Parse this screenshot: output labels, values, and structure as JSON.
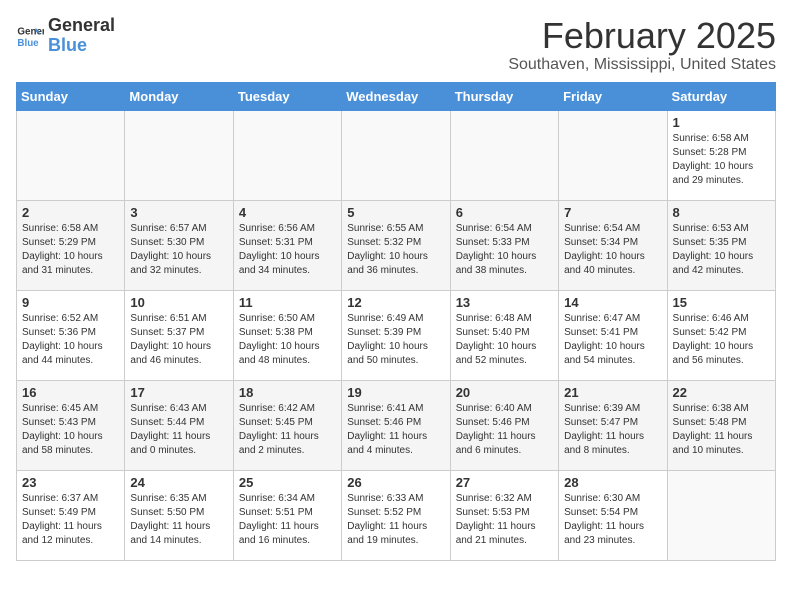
{
  "header": {
    "logo_text_general": "General",
    "logo_text_blue": "Blue",
    "month": "February 2025",
    "location": "Southaven, Mississippi, United States"
  },
  "days_of_week": [
    "Sunday",
    "Monday",
    "Tuesday",
    "Wednesday",
    "Thursday",
    "Friday",
    "Saturday"
  ],
  "weeks": [
    [
      {
        "day": "",
        "info": ""
      },
      {
        "day": "",
        "info": ""
      },
      {
        "day": "",
        "info": ""
      },
      {
        "day": "",
        "info": ""
      },
      {
        "day": "",
        "info": ""
      },
      {
        "day": "",
        "info": ""
      },
      {
        "day": "1",
        "info": "Sunrise: 6:58 AM\nSunset: 5:28 PM\nDaylight: 10 hours and 29 minutes."
      }
    ],
    [
      {
        "day": "2",
        "info": "Sunrise: 6:58 AM\nSunset: 5:29 PM\nDaylight: 10 hours and 31 minutes."
      },
      {
        "day": "3",
        "info": "Sunrise: 6:57 AM\nSunset: 5:30 PM\nDaylight: 10 hours and 32 minutes."
      },
      {
        "day": "4",
        "info": "Sunrise: 6:56 AM\nSunset: 5:31 PM\nDaylight: 10 hours and 34 minutes."
      },
      {
        "day": "5",
        "info": "Sunrise: 6:55 AM\nSunset: 5:32 PM\nDaylight: 10 hours and 36 minutes."
      },
      {
        "day": "6",
        "info": "Sunrise: 6:54 AM\nSunset: 5:33 PM\nDaylight: 10 hours and 38 minutes."
      },
      {
        "day": "7",
        "info": "Sunrise: 6:54 AM\nSunset: 5:34 PM\nDaylight: 10 hours and 40 minutes."
      },
      {
        "day": "8",
        "info": "Sunrise: 6:53 AM\nSunset: 5:35 PM\nDaylight: 10 hours and 42 minutes."
      }
    ],
    [
      {
        "day": "9",
        "info": "Sunrise: 6:52 AM\nSunset: 5:36 PM\nDaylight: 10 hours and 44 minutes."
      },
      {
        "day": "10",
        "info": "Sunrise: 6:51 AM\nSunset: 5:37 PM\nDaylight: 10 hours and 46 minutes."
      },
      {
        "day": "11",
        "info": "Sunrise: 6:50 AM\nSunset: 5:38 PM\nDaylight: 10 hours and 48 minutes."
      },
      {
        "day": "12",
        "info": "Sunrise: 6:49 AM\nSunset: 5:39 PM\nDaylight: 10 hours and 50 minutes."
      },
      {
        "day": "13",
        "info": "Sunrise: 6:48 AM\nSunset: 5:40 PM\nDaylight: 10 hours and 52 minutes."
      },
      {
        "day": "14",
        "info": "Sunrise: 6:47 AM\nSunset: 5:41 PM\nDaylight: 10 hours and 54 minutes."
      },
      {
        "day": "15",
        "info": "Sunrise: 6:46 AM\nSunset: 5:42 PM\nDaylight: 10 hours and 56 minutes."
      }
    ],
    [
      {
        "day": "16",
        "info": "Sunrise: 6:45 AM\nSunset: 5:43 PM\nDaylight: 10 hours and 58 minutes."
      },
      {
        "day": "17",
        "info": "Sunrise: 6:43 AM\nSunset: 5:44 PM\nDaylight: 11 hours and 0 minutes."
      },
      {
        "day": "18",
        "info": "Sunrise: 6:42 AM\nSunset: 5:45 PM\nDaylight: 11 hours and 2 minutes."
      },
      {
        "day": "19",
        "info": "Sunrise: 6:41 AM\nSunset: 5:46 PM\nDaylight: 11 hours and 4 minutes."
      },
      {
        "day": "20",
        "info": "Sunrise: 6:40 AM\nSunset: 5:46 PM\nDaylight: 11 hours and 6 minutes."
      },
      {
        "day": "21",
        "info": "Sunrise: 6:39 AM\nSunset: 5:47 PM\nDaylight: 11 hours and 8 minutes."
      },
      {
        "day": "22",
        "info": "Sunrise: 6:38 AM\nSunset: 5:48 PM\nDaylight: 11 hours and 10 minutes."
      }
    ],
    [
      {
        "day": "23",
        "info": "Sunrise: 6:37 AM\nSunset: 5:49 PM\nDaylight: 11 hours and 12 minutes."
      },
      {
        "day": "24",
        "info": "Sunrise: 6:35 AM\nSunset: 5:50 PM\nDaylight: 11 hours and 14 minutes."
      },
      {
        "day": "25",
        "info": "Sunrise: 6:34 AM\nSunset: 5:51 PM\nDaylight: 11 hours and 16 minutes."
      },
      {
        "day": "26",
        "info": "Sunrise: 6:33 AM\nSunset: 5:52 PM\nDaylight: 11 hours and 19 minutes."
      },
      {
        "day": "27",
        "info": "Sunrise: 6:32 AM\nSunset: 5:53 PM\nDaylight: 11 hours and 21 minutes."
      },
      {
        "day": "28",
        "info": "Sunrise: 6:30 AM\nSunset: 5:54 PM\nDaylight: 11 hours and 23 minutes."
      },
      {
        "day": "",
        "info": ""
      }
    ]
  ]
}
